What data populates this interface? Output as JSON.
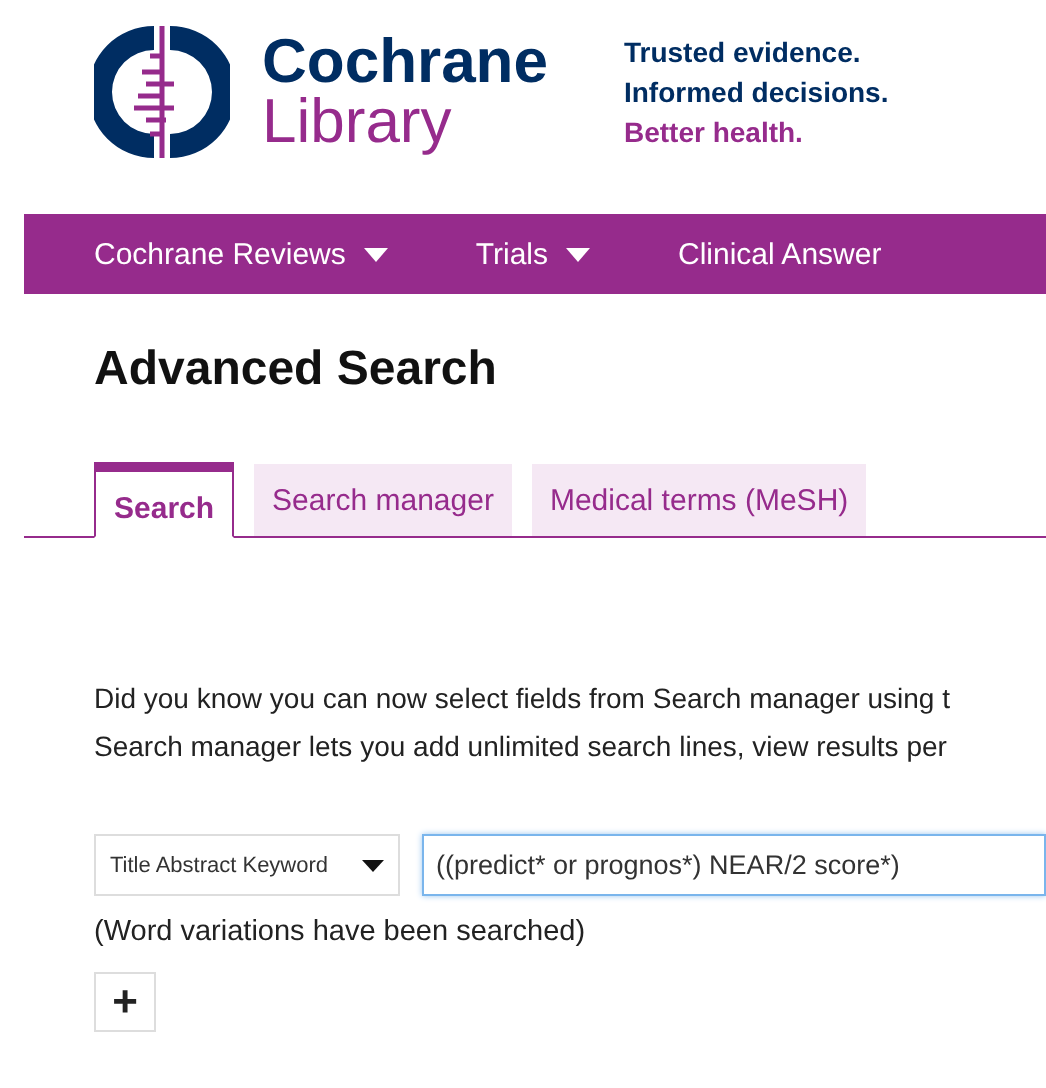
{
  "brand": {
    "name_top": "Cochrane",
    "name_bottom": "Library",
    "tagline": [
      "Trusted evidence.",
      "Informed decisions.",
      "Better health."
    ]
  },
  "nav": [
    {
      "label": "Cochrane Reviews",
      "has_menu": true
    },
    {
      "label": "Trials",
      "has_menu": true
    },
    {
      "label": "Clinical Answer",
      "has_menu": false
    }
  ],
  "page_title": "Advanced Search",
  "tabs": [
    {
      "label": "Search",
      "selected": true
    },
    {
      "label": "Search manager",
      "selected": false
    },
    {
      "label": "Medical terms (MeSH)",
      "selected": false
    }
  ],
  "notice": [
    "Did you know you can now select fields from Search manager using t",
    "Search manager lets you add unlimited search lines, view results per"
  ],
  "search_line": {
    "field": "Title Abstract Keyword",
    "query": "((predict* or prognos*) NEAR/2 score*)",
    "focused": true
  },
  "hint": "(Word variations have been searched)",
  "add_button": "+"
}
